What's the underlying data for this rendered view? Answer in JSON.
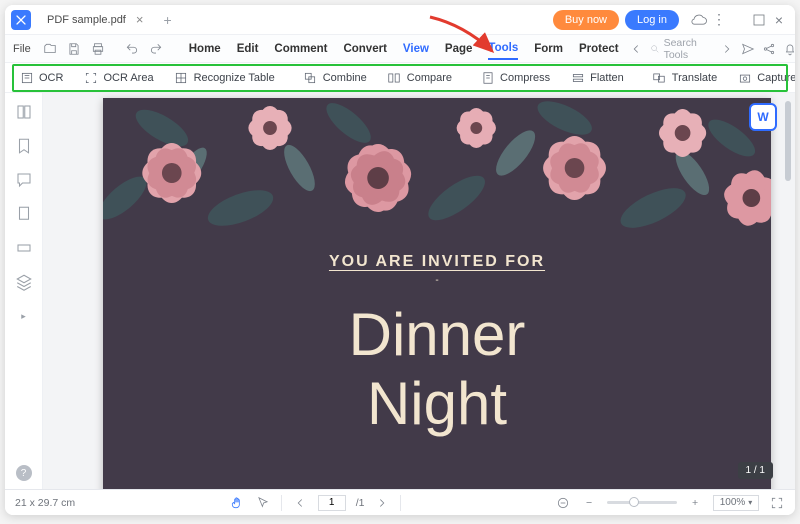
{
  "titlebar": {
    "filename": "PDF sample.pdf",
    "buy_label": "Buy now",
    "login_label": "Log in"
  },
  "menubar": {
    "file_label": "File",
    "items": [
      "Home",
      "Edit",
      "Comment",
      "Convert",
      "View",
      "Page",
      "Tools",
      "Form",
      "Protect"
    ],
    "search_placeholder": "Search Tools"
  },
  "toolbar": {
    "ocr": "OCR",
    "ocr_area": "OCR Area",
    "recognize_table": "Recognize Table",
    "combine": "Combine",
    "compare": "Compare",
    "compress": "Compress",
    "flatten": "Flatten",
    "translate": "Translate",
    "capture": "Capture"
  },
  "document": {
    "invited_line": "YOU ARE INVITED FOR",
    "main_line1": "Dinner",
    "main_line2": "Night",
    "page_indicator": "1 / 1"
  },
  "statusbar": {
    "dimensions": "21 x 29.7 cm",
    "page_current": "1",
    "page_total": "/1",
    "zoom_value": "100%"
  },
  "word_badge": "W"
}
